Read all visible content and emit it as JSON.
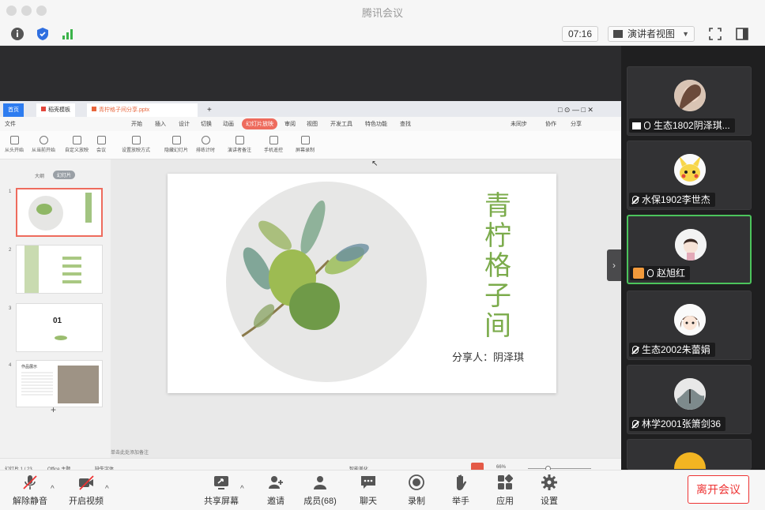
{
  "window": {
    "title": "腾讯会议"
  },
  "toolbar": {
    "time": "07:16",
    "view_mode": "演讲者视图"
  },
  "shared_screen": {
    "tabs": [
      "首页",
      "稻壳模板",
      "青柠格子间分享.pptx"
    ],
    "menu_items": [
      "文件",
      "开始",
      "插入",
      "设计",
      "切换",
      "动画",
      "幻灯片放映",
      "审阅",
      "视图",
      "开发工具",
      "特色功能",
      "查找",
      "未同步",
      "协作",
      "分享"
    ],
    "ribbon_items": [
      "从头开始",
      "从当前开始",
      "自定义放映",
      "会议",
      "设置放映方式",
      "隐藏幻灯片",
      "排练计时",
      "演讲者备注",
      "手机遥控",
      "屏幕录制"
    ],
    "outline_tabs": [
      "大纲",
      "幻灯片"
    ],
    "thumb_numbers": [
      "1",
      "2",
      "3",
      "4"
    ],
    "thumb3_text": "01",
    "thumb4_text": "作品展示",
    "slide": {
      "title": "青柠格子间",
      "presenter": "分享人：阴泽琪",
      "watermark": "青柠"
    },
    "notes_placeholder": "单击此处添加备注",
    "status": {
      "slide_counter": "幻灯片 1 / 23",
      "theme": "Office 主题",
      "font": "缺失字体",
      "smart_beautify": "智能美化",
      "zoom": "66%"
    }
  },
  "participants": [
    {
      "name": "生态1802阴泽琪...",
      "mic": "on",
      "sharing": true
    },
    {
      "name": "水保1902李世杰",
      "mic": "muted"
    },
    {
      "name": "赵旭红",
      "mic": "on",
      "host": true,
      "active": true
    },
    {
      "name": "生态2002朱蕾娟",
      "mic": "muted"
    },
    {
      "name": "林学2001张箫剑36",
      "mic": "muted"
    }
  ],
  "bottom": {
    "unmute": "解除静音",
    "video": "开启视频",
    "share": "共享屏幕",
    "invite": "邀请",
    "members": "成员(68)",
    "chat": "聊天",
    "record": "录制",
    "raise_hand": "举手",
    "apps": "应用",
    "settings": "设置",
    "leave": "离开会议"
  },
  "colors": {
    "accent_green": "#7bab4b",
    "leave_red": "#e33333",
    "active_border": "#4cc45c"
  }
}
